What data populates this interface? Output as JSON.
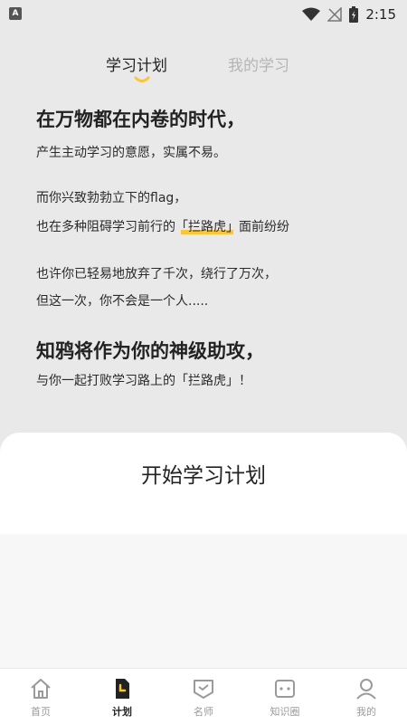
{
  "status_bar": {
    "time": "2:15"
  },
  "tabs": [
    {
      "label": "学习计划",
      "active": true
    },
    {
      "label": "我的学习",
      "active": false
    }
  ],
  "intro": {
    "headline1": "在万物都在内卷的时代，",
    "line1": "产生主动学习的意愿，实属不易。",
    "line2": "而你兴致勃勃立下的flag，",
    "line3_pre": "也在多种阻碍学习前行的",
    "line3_highlight": "「拦路虎」",
    "line3_post": "面前纷纷",
    "line4": "也许你已轻易地放弃了千次，绕行了万次，",
    "line5": "但这一次，你不会是一个人.....",
    "headline2": "知鸦将作为你的神级助攻，",
    "line6": "与你一起打败学习路上的「拦路虎」！"
  },
  "start_button": {
    "label": "开始学习计划"
  },
  "bottom_nav": [
    {
      "label": "首页",
      "icon": "home-icon",
      "active": false
    },
    {
      "label": "计划",
      "icon": "plan-icon",
      "active": true
    },
    {
      "label": "名师",
      "icon": "teacher-icon",
      "active": false
    },
    {
      "label": "知识圈",
      "icon": "knowledge-circle-icon",
      "active": false
    },
    {
      "label": "我的",
      "icon": "profile-icon",
      "active": false
    }
  ],
  "colors": {
    "accent": "#f7c63a",
    "background": "#e9e9e9",
    "sheet": "#ffffff"
  }
}
